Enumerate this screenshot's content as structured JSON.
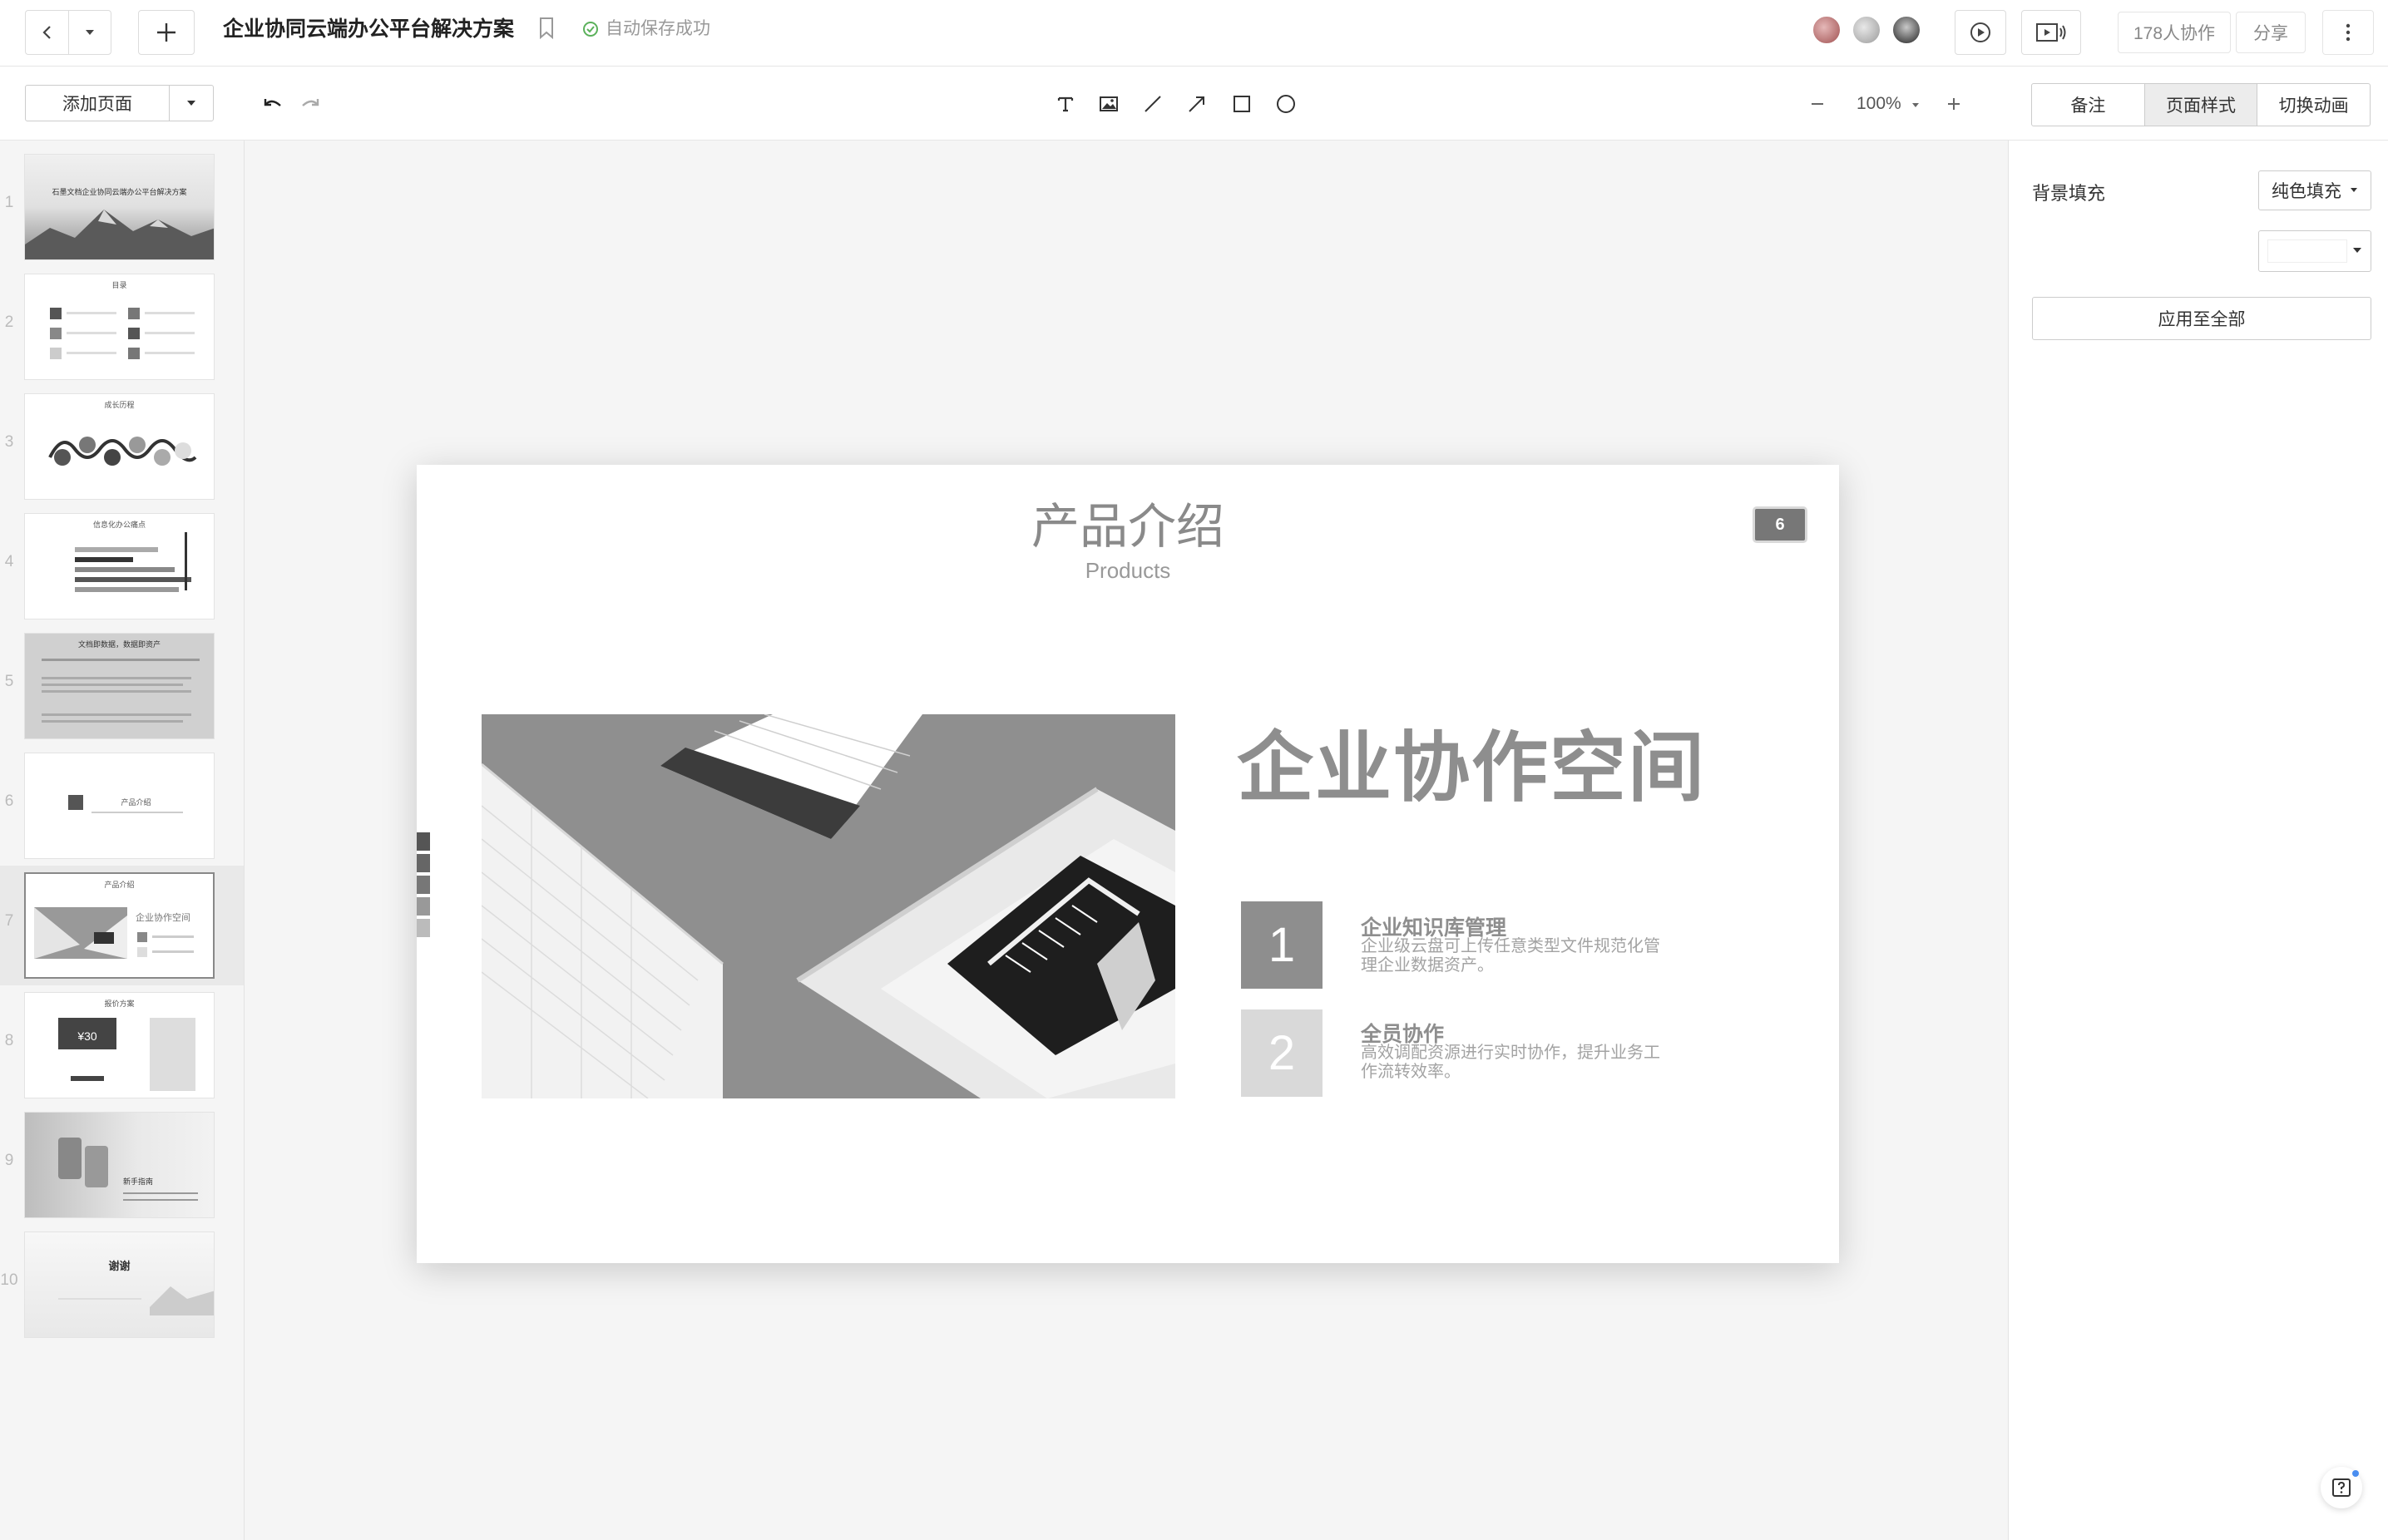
{
  "header": {
    "doc_title": "企业协同云端办公平台解决方案",
    "save_status": "自动保存成功",
    "collab_count": "178人协作",
    "share_label": "分享"
  },
  "toolbar": {
    "add_page_label": "添加页面",
    "zoom_level": "100%",
    "tabs": [
      {
        "label": "备注",
        "active": false
      },
      {
        "label": "页面样式",
        "active": true
      },
      {
        "label": "切换动画",
        "active": false
      }
    ]
  },
  "thumbnails": [
    {
      "num": "1",
      "title": "石墨文档企业协同云端办公平台解决方案"
    },
    {
      "num": "2",
      "title": "目录"
    },
    {
      "num": "3",
      "title": "成长历程"
    },
    {
      "num": "4",
      "title": "信息化办公痛点"
    },
    {
      "num": "5",
      "title": "文档即数据，数据即资产"
    },
    {
      "num": "6",
      "title": "产品介绍"
    },
    {
      "num": "7",
      "title": "产品介绍",
      "subtitle": "企业协作空间",
      "active": true
    },
    {
      "num": "8",
      "title": "报价方案",
      "price": "¥30"
    },
    {
      "num": "9",
      "title": "新手指南"
    },
    {
      "num": "10",
      "title": "谢谢"
    }
  ],
  "slide": {
    "title": "产品介绍",
    "subtitle": "Products",
    "page_badge": "6",
    "heading": "企业协作空间",
    "features": [
      {
        "num": "1",
        "title": "企业知识库管理",
        "desc": "企业级云盘可上传任意类型文件规范化管理企业数据资产。",
        "color": "#8e8e8e"
      },
      {
        "num": "2",
        "title": "全员协作",
        "desc": "高效调配资源进行实时协作，提升业务工作流转效率。",
        "color": "#d9d9d9"
      }
    ]
  },
  "right_panel": {
    "bg_fill_label": "背景填充",
    "fill_type": "纯色填充",
    "fill_color": "#ffffff",
    "apply_all_label": "应用至全部"
  }
}
